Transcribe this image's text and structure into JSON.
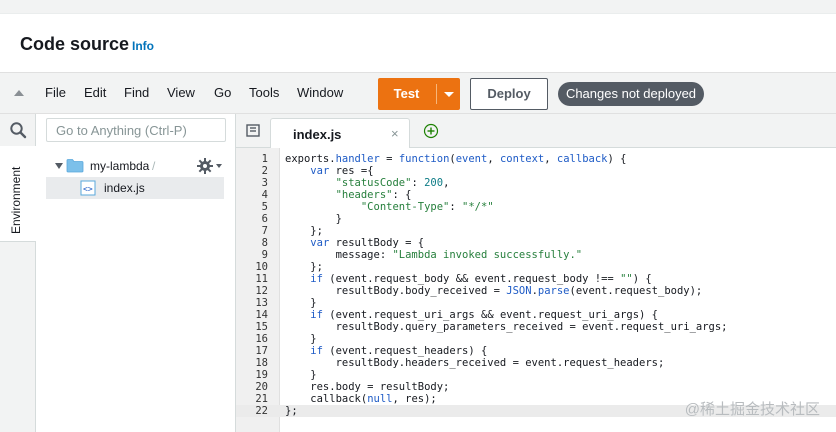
{
  "header": {
    "title": "Code source",
    "info": "Info"
  },
  "menu": {
    "items": [
      "File",
      "Edit",
      "Find",
      "View",
      "Go",
      "Tools",
      "Window"
    ],
    "test_label": "Test",
    "deploy_label": "Deploy",
    "status_badge": "Changes not deployed"
  },
  "sidebar": {
    "tab_label": "Environment",
    "search_placeholder": "Go to Anything (Ctrl-P)",
    "folder": "my-lambda",
    "folder_suffix": "/",
    "file": "index.js"
  },
  "editor": {
    "tab_label": "index.js",
    "close_glyph": "×",
    "lines": [
      "exports.handler = function(event, context, callback) {",
      "    var res ={",
      "        \"statusCode\": 200,",
      "        \"headers\": {",
      "            \"Content-Type\": \"*/*\"",
      "        }",
      "    };",
      "    var resultBody = {",
      "        message: \"Lambda invoked successfully.\"",
      "    };",
      "    if (event.request_body && event.request_body !== \"\") {",
      "        resultBody.body_received = JSON.parse(event.request_body);",
      "    }",
      "    if (event.request_uri_args && event.request_uri_args) {",
      "        resultBody.query_parameters_received = event.request_uri_args;",
      "    }",
      "    if (event.request_headers) {",
      "        resultBody.headers_received = event.request_headers;",
      "    }",
      "    res.body = resultBody;",
      "    callback(null, res);",
      "};"
    ]
  },
  "watermark": "@稀土掘金技术社区",
  "colors": {
    "accent": "#ec7211",
    "link": "#0073bb",
    "badge": "#545b64"
  },
  "icons": [
    "search-icon",
    "folder-icon",
    "js-file-icon",
    "gear-icon",
    "tabs-menu-icon",
    "add-tab-icon"
  ]
}
